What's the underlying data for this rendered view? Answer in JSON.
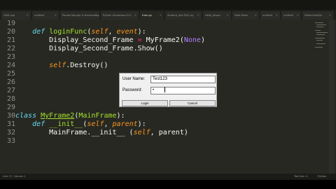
{
  "tabs": [
    {
      "label": "GDD.cpp"
    },
    {
      "label": "untitled"
    },
    {
      "label": "Pocket Monger & Dominating"
    },
    {
      "label": "Python Exceptions & E"
    },
    {
      "label": "fram.py"
    },
    {
      "label": "Student_info DOC.py"
    },
    {
      "label": "Hello_Wrap.r"
    },
    {
      "label": "Data Stats"
    },
    {
      "label": "untitled"
    },
    {
      "label": "untitled"
    },
    {
      "label": "DistinctionDiv"
    }
  ],
  "editor": {
    "lines": [
      {
        "n": "19",
        "html": ""
      },
      {
        "n": "20",
        "html": "    <span class='kw'>def</span> <span class='fn'>loginFunc</span>(<span class='arg'>self</span>, <span class='arg'>event</span>):"
      },
      {
        "n": "21",
        "html": "        Display_Second_Frame <span class='op'>=</span> MyFrame2(<span class='none'>None</span>)"
      },
      {
        "n": "22",
        "html": "        Display_Second_Frame.Show()"
      },
      {
        "n": "23",
        "html": ""
      },
      {
        "n": "24",
        "html": "        <span class='arg'>self</span>.Destroy()"
      },
      {
        "n": "25",
        "html": ""
      },
      {
        "n": "26",
        "html": ""
      },
      {
        "n": "27",
        "html": ""
      },
      {
        "n": "28",
        "html": ""
      },
      {
        "n": "29",
        "html": ""
      },
      {
        "n": "30",
        "html": "<span class='kw'>class</span> <span class='cls'>MyFrame2</span>(<span class='fn'>MainFrame</span>):"
      },
      {
        "n": "31",
        "html": "    <span class='kw'>def</span> <span class='fn'>__init__</span>(<span class='arg'>self</span>, <span class='arg'>parent</span>):"
      },
      {
        "n": "32",
        "html": "        MainFrame.__init__ (<span class='arg'>self</span>, parent)"
      },
      {
        "n": "33",
        "html": ""
      }
    ]
  },
  "dialog": {
    "username_label": "User Name:",
    "username_value": "Test123",
    "password_label": "Password:",
    "password_value": "•",
    "login_label": "Login",
    "cancel_label": "Cancel"
  },
  "status": {
    "left": "Line 27, Column 1",
    "tab_size": "Tab Size: 4",
    "syntax": "Python"
  },
  "colors": {
    "editor_bg": "#272822",
    "keyword": "#66d9ef",
    "function": "#a6e22e",
    "argument": "#fd971f",
    "operator": "#f92672",
    "constant": "#ae81ff"
  }
}
